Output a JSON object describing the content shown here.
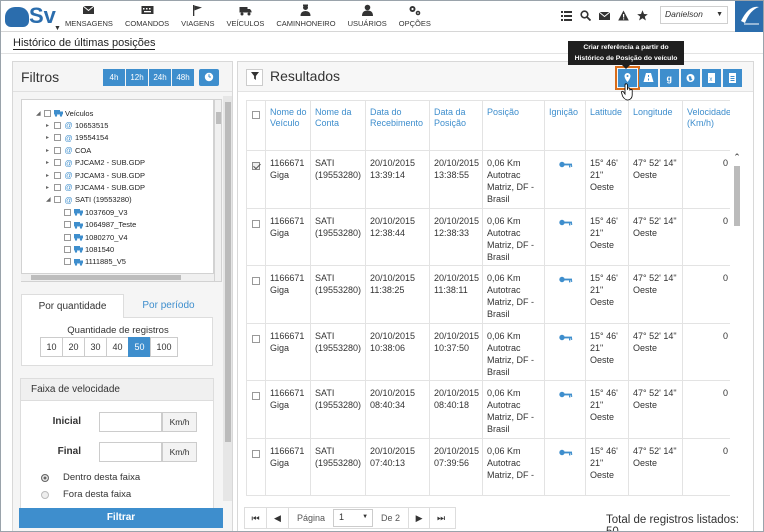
{
  "header": {
    "logo_text": "Sv",
    "nav": [
      {
        "label": "MENSAGENS",
        "icon": "envelope-icon"
      },
      {
        "label": "COMANDOS",
        "icon": "keyboard-icon"
      },
      {
        "label": "VIAGENS",
        "icon": "flag-icon"
      },
      {
        "label": "VEÍCULOS",
        "icon": "truck-icon"
      },
      {
        "label": "CAMINHONEIRO",
        "icon": "driver-icon"
      },
      {
        "label": "USUÁRIOS",
        "icon": "user-icon"
      },
      {
        "label": "OPÇÕES",
        "icon": "gears-icon"
      }
    ],
    "user": "Danielson",
    "brand": "AUTOTRAC"
  },
  "breadcrumb": "Histórico de últimas posições",
  "filters": {
    "title": "Filtros",
    "time_buttons": [
      "4h",
      "12h",
      "24h",
      "48h"
    ],
    "tree": [
      {
        "label": "Veículos",
        "level": 0,
        "expanded": true
      },
      {
        "label": "10653515",
        "level": 1
      },
      {
        "label": "19554154",
        "level": 1
      },
      {
        "label": "COA",
        "level": 1
      },
      {
        "label": "PJCAM2 - SUB.GDP",
        "level": 1
      },
      {
        "label": "PJCAM3 - SUB.GDP",
        "level": 1
      },
      {
        "label": "PJCAM4 - SUB.GDP",
        "level": 1
      },
      {
        "label": "SATI (19553280)",
        "level": 1,
        "expanded": true
      },
      {
        "label": "1037609_V3",
        "level": 2
      },
      {
        "label": "1064987_Teste",
        "level": 2
      },
      {
        "label": "1080270_V4",
        "level": 2
      },
      {
        "label": "1081540",
        "level": 2
      },
      {
        "label": "1111885_V5",
        "level": 2
      }
    ],
    "tabs": [
      "Por quantidade",
      "Por período"
    ],
    "quantity_label": "Quantidade de registros",
    "quantity_options": [
      "10",
      "20",
      "30",
      "40",
      "50",
      "100"
    ],
    "quantity_selected": "50",
    "speed": {
      "title": "Faixa de velocidade",
      "initial_label": "Inicial",
      "final_label": "Final",
      "unit": "Km/h",
      "options": [
        "Dentro desta faixa",
        "Fora desta faixa"
      ],
      "selected": "Dentro desta faixa"
    },
    "submit_label": "Filtrar"
  },
  "results": {
    "title": "Resultados",
    "tooltip": "Criar referência a partir do Histórico de Posição do veículo",
    "columns": [
      "Nome do Veículo",
      "Nome da Conta",
      "Data do Recebimento",
      "Data da Posição",
      "Posição",
      "Ignição",
      "Latitude",
      "Longitude",
      "Velocidade (Km/h)"
    ],
    "rows": [
      {
        "vehicle": "1166671 Giga",
        "account": "SATI (19553280)",
        "received": "20/10/2015 13:39:14",
        "position_date": "20/10/2015 13:38:55",
        "position": "0,06 Km Autotrac Matriz, DF - Brasil",
        "lat": "15° 46' 21\" Oeste",
        "lon": "47° 52' 14\" Oeste",
        "speed": "0",
        "checked": true
      },
      {
        "vehicle": "1166671 Giga",
        "account": "SATI (19553280)",
        "received": "20/10/2015 12:38:44",
        "position_date": "20/10/2015 12:38:33",
        "position": "0,06 Km Autotrac Matriz, DF - Brasil",
        "lat": "15° 46' 21\" Oeste",
        "lon": "47° 52' 14\" Oeste",
        "speed": "0",
        "checked": false
      },
      {
        "vehicle": "1166671 Giga",
        "account": "SATI (19553280)",
        "received": "20/10/2015 11:38:25",
        "position_date": "20/10/2015 11:38:11",
        "position": "0,06 Km Autotrac Matriz, DF - Brasil",
        "lat": "15° 46' 21\" Oeste",
        "lon": "47° 52' 14\" Oeste",
        "speed": "0",
        "checked": false
      },
      {
        "vehicle": "1166671 Giga",
        "account": "SATI (19553280)",
        "received": "20/10/2015 10:38:06",
        "position_date": "20/10/2015 10:37:50",
        "position": "0,06 Km Autotrac Matriz, DF - Brasil",
        "lat": "15° 46' 21\" Oeste",
        "lon": "47° 52' 14\" Oeste",
        "speed": "0",
        "checked": false
      },
      {
        "vehicle": "1166671 Giga",
        "account": "SATI (19553280)",
        "received": "20/10/2015 08:40:34",
        "position_date": "20/10/2015 08:40:18",
        "position": "0,06 Km Autotrac Matriz, DF - Brasil",
        "lat": "15° 46' 21\" Oeste",
        "lon": "47° 52' 14\" Oeste",
        "speed": "0",
        "checked": false
      },
      {
        "vehicle": "1166671 Giga",
        "account": "SATI (19553280)",
        "received": "20/10/2015 07:40:13",
        "position_date": "20/10/2015 07:39:56",
        "position": "0,06 Km Autotrac Matriz, DF -",
        "lat": "15° 46' 21\" Oeste",
        "lon": "47° 52' 14\" Oeste",
        "speed": "0",
        "checked": false
      }
    ],
    "pager": {
      "page_label": "Página",
      "page": "1",
      "of_label": "De 2"
    },
    "total_label": "Total de registros listados: 50"
  },
  "colors": {
    "accent": "#3e8ecd",
    "brand": "#2b6dad",
    "highlight": "#d96d1a"
  }
}
